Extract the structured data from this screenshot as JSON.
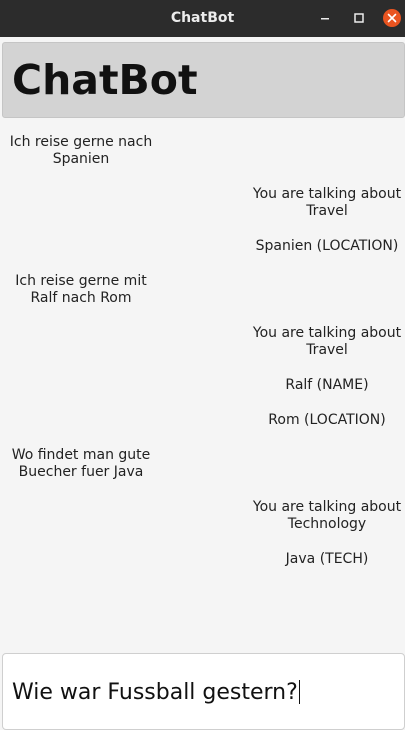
{
  "window": {
    "title": "ChatBot",
    "controls": [
      "minimize-icon",
      "maximize-icon",
      "close-icon"
    ],
    "close_color": "#e95420"
  },
  "header": {
    "title": "ChatBot",
    "background": "#d3d3d3"
  },
  "messages": [
    {
      "role": "user",
      "text": "Ich reise gerne nach Spanien"
    },
    {
      "role": "bot",
      "text": "You are talking about Travel"
    },
    {
      "role": "bot",
      "text": "Spanien (LOCATION)"
    },
    {
      "role": "user",
      "text": "Ich reise gerne mit Ralf nach Rom"
    },
    {
      "role": "bot",
      "text": "You are talking about Travel"
    },
    {
      "role": "bot",
      "text": "Ralf (NAME)"
    },
    {
      "role": "bot",
      "text": "Rom (LOCATION)"
    },
    {
      "role": "user",
      "text": "Wo findet man gute Buecher fuer Java"
    },
    {
      "role": "bot",
      "text": "You are talking about Technology"
    },
    {
      "role": "bot",
      "text": "Java (TECH)"
    }
  ],
  "input": {
    "value": "Wie war Fussball gestern?"
  }
}
